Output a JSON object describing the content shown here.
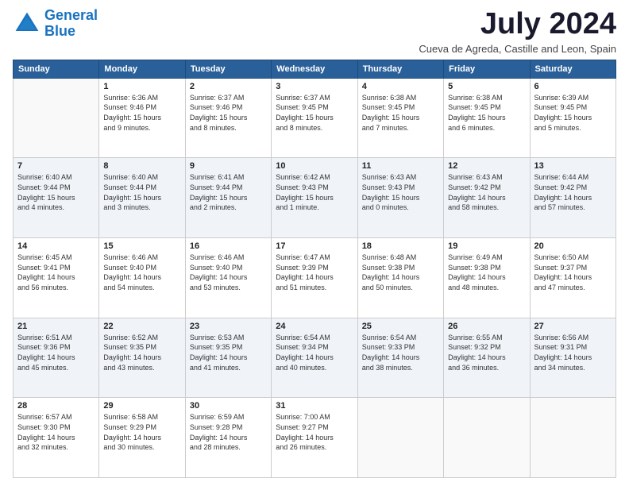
{
  "header": {
    "logo_line1": "General",
    "logo_line2": "Blue",
    "month_title": "July 2024",
    "location": "Cueva de Agreda, Castille and Leon, Spain"
  },
  "days_of_week": [
    "Sunday",
    "Monday",
    "Tuesday",
    "Wednesday",
    "Thursday",
    "Friday",
    "Saturday"
  ],
  "weeks": [
    [
      {
        "day": "",
        "info": ""
      },
      {
        "day": "1",
        "info": "Sunrise: 6:36 AM\nSunset: 9:46 PM\nDaylight: 15 hours\nand 9 minutes."
      },
      {
        "day": "2",
        "info": "Sunrise: 6:37 AM\nSunset: 9:46 PM\nDaylight: 15 hours\nand 8 minutes."
      },
      {
        "day": "3",
        "info": "Sunrise: 6:37 AM\nSunset: 9:45 PM\nDaylight: 15 hours\nand 8 minutes."
      },
      {
        "day": "4",
        "info": "Sunrise: 6:38 AM\nSunset: 9:45 PM\nDaylight: 15 hours\nand 7 minutes."
      },
      {
        "day": "5",
        "info": "Sunrise: 6:38 AM\nSunset: 9:45 PM\nDaylight: 15 hours\nand 6 minutes."
      },
      {
        "day": "6",
        "info": "Sunrise: 6:39 AM\nSunset: 9:45 PM\nDaylight: 15 hours\nand 5 minutes."
      }
    ],
    [
      {
        "day": "7",
        "info": "Sunrise: 6:40 AM\nSunset: 9:44 PM\nDaylight: 15 hours\nand 4 minutes."
      },
      {
        "day": "8",
        "info": "Sunrise: 6:40 AM\nSunset: 9:44 PM\nDaylight: 15 hours\nand 3 minutes."
      },
      {
        "day": "9",
        "info": "Sunrise: 6:41 AM\nSunset: 9:44 PM\nDaylight: 15 hours\nand 2 minutes."
      },
      {
        "day": "10",
        "info": "Sunrise: 6:42 AM\nSunset: 9:43 PM\nDaylight: 15 hours\nand 1 minute."
      },
      {
        "day": "11",
        "info": "Sunrise: 6:43 AM\nSunset: 9:43 PM\nDaylight: 15 hours\nand 0 minutes."
      },
      {
        "day": "12",
        "info": "Sunrise: 6:43 AM\nSunset: 9:42 PM\nDaylight: 14 hours\nand 58 minutes."
      },
      {
        "day": "13",
        "info": "Sunrise: 6:44 AM\nSunset: 9:42 PM\nDaylight: 14 hours\nand 57 minutes."
      }
    ],
    [
      {
        "day": "14",
        "info": "Sunrise: 6:45 AM\nSunset: 9:41 PM\nDaylight: 14 hours\nand 56 minutes."
      },
      {
        "day": "15",
        "info": "Sunrise: 6:46 AM\nSunset: 9:40 PM\nDaylight: 14 hours\nand 54 minutes."
      },
      {
        "day": "16",
        "info": "Sunrise: 6:46 AM\nSunset: 9:40 PM\nDaylight: 14 hours\nand 53 minutes."
      },
      {
        "day": "17",
        "info": "Sunrise: 6:47 AM\nSunset: 9:39 PM\nDaylight: 14 hours\nand 51 minutes."
      },
      {
        "day": "18",
        "info": "Sunrise: 6:48 AM\nSunset: 9:38 PM\nDaylight: 14 hours\nand 50 minutes."
      },
      {
        "day": "19",
        "info": "Sunrise: 6:49 AM\nSunset: 9:38 PM\nDaylight: 14 hours\nand 48 minutes."
      },
      {
        "day": "20",
        "info": "Sunrise: 6:50 AM\nSunset: 9:37 PM\nDaylight: 14 hours\nand 47 minutes."
      }
    ],
    [
      {
        "day": "21",
        "info": "Sunrise: 6:51 AM\nSunset: 9:36 PM\nDaylight: 14 hours\nand 45 minutes."
      },
      {
        "day": "22",
        "info": "Sunrise: 6:52 AM\nSunset: 9:35 PM\nDaylight: 14 hours\nand 43 minutes."
      },
      {
        "day": "23",
        "info": "Sunrise: 6:53 AM\nSunset: 9:35 PM\nDaylight: 14 hours\nand 41 minutes."
      },
      {
        "day": "24",
        "info": "Sunrise: 6:54 AM\nSunset: 9:34 PM\nDaylight: 14 hours\nand 40 minutes."
      },
      {
        "day": "25",
        "info": "Sunrise: 6:54 AM\nSunset: 9:33 PM\nDaylight: 14 hours\nand 38 minutes."
      },
      {
        "day": "26",
        "info": "Sunrise: 6:55 AM\nSunset: 9:32 PM\nDaylight: 14 hours\nand 36 minutes."
      },
      {
        "day": "27",
        "info": "Sunrise: 6:56 AM\nSunset: 9:31 PM\nDaylight: 14 hours\nand 34 minutes."
      }
    ],
    [
      {
        "day": "28",
        "info": "Sunrise: 6:57 AM\nSunset: 9:30 PM\nDaylight: 14 hours\nand 32 minutes."
      },
      {
        "day": "29",
        "info": "Sunrise: 6:58 AM\nSunset: 9:29 PM\nDaylight: 14 hours\nand 30 minutes."
      },
      {
        "day": "30",
        "info": "Sunrise: 6:59 AM\nSunset: 9:28 PM\nDaylight: 14 hours\nand 28 minutes."
      },
      {
        "day": "31",
        "info": "Sunrise: 7:00 AM\nSunset: 9:27 PM\nDaylight: 14 hours\nand 26 minutes."
      },
      {
        "day": "",
        "info": ""
      },
      {
        "day": "",
        "info": ""
      },
      {
        "day": "",
        "info": ""
      }
    ]
  ]
}
